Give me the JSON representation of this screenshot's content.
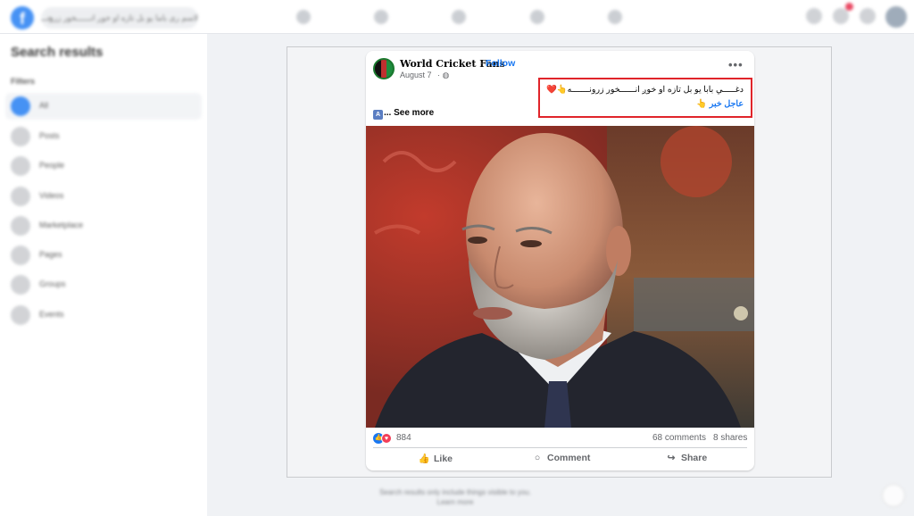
{
  "topbar": {
    "search_value": "لاسم ری باما یو بل تازه او خوږ انــــــخور زرونـــــه"
  },
  "sidebar": {
    "title": "Search results",
    "filters_label": "Filters",
    "items": [
      {
        "label": "All"
      },
      {
        "label": "Posts"
      },
      {
        "label": "People"
      },
      {
        "label": "Videos"
      },
      {
        "label": "Marketplace"
      },
      {
        "label": "Pages"
      },
      {
        "label": "Groups"
      },
      {
        "label": "Events"
      }
    ]
  },
  "footer": {
    "line1": "Search results only include things visible to you.",
    "line2": "Learn more"
  },
  "post": {
    "page_name": "World Cricket Fans",
    "separator": "·",
    "follow_label": "Follow",
    "date": "August 7",
    "date_sep": "·",
    "more_label": "•••",
    "text_line1": "دغـــــي بابا يو بل تازه او خوږ انــــــخور زرونـــــــه👆❤️",
    "text_line2": "عاجل خبر 👆",
    "see_more": "... See more",
    "reactions_count": "884",
    "comments": "68 comments",
    "shares": "8 shares",
    "actions": {
      "like": "Like",
      "comment": "Comment",
      "share": "Share"
    }
  }
}
